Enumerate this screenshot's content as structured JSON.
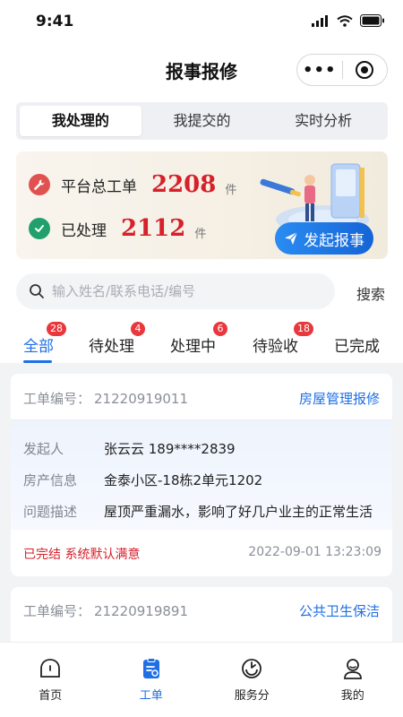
{
  "status_bar": {
    "time": "9:41"
  },
  "nav": {
    "title": "报事报修",
    "more_label": "•••"
  },
  "segments": [
    {
      "label": "我处理的",
      "active": true
    },
    {
      "label": "我提交的",
      "active": false
    },
    {
      "label": "实时分析",
      "active": false
    }
  ],
  "summary": {
    "total_label": "平台总工单",
    "total_value": "2208",
    "total_unit": "件",
    "done_label": "已处理",
    "done_value": "2112",
    "done_unit": "件",
    "report_button": "发起报事"
  },
  "search": {
    "placeholder": "输入姓名/联系电话/编号",
    "button": "搜索"
  },
  "status_tabs": [
    {
      "label": "全部",
      "badge": "28",
      "active": true
    },
    {
      "label": "待处理",
      "badge": "4",
      "active": false
    },
    {
      "label": "处理中",
      "badge": "6",
      "active": false
    },
    {
      "label": "待验收",
      "badge": "18",
      "active": false
    },
    {
      "label": "已完成",
      "badge": "",
      "active": false
    }
  ],
  "orders": [
    {
      "no_label": "工单编号：",
      "no": "21220919011",
      "type": "房屋管理报修",
      "fields": [
        {
          "k": "发起人",
          "v": "张云云 189****2839"
        },
        {
          "k": "房产信息",
          "v": "金泰小区-18栋2单元1202"
        },
        {
          "k": "问题描述",
          "v": "屋顶严重漏水，影响了好几户业主的正常生活"
        }
      ],
      "status": "已完结 系统默认满意",
      "time": "2022-09-01  13:23:09"
    },
    {
      "no_label": "工单编号：",
      "no": "21220919891",
      "type": "公共卫生保洁"
    }
  ],
  "tabbar": [
    {
      "label": "首页",
      "icon": "home-icon",
      "active": false
    },
    {
      "label": "工单",
      "icon": "ticket-icon",
      "active": true
    },
    {
      "label": "服务分",
      "icon": "score-icon",
      "active": false
    },
    {
      "label": "我的",
      "icon": "user-icon",
      "active": false
    }
  ],
  "colors": {
    "accent": "#1f6fe5",
    "danger": "#d6212b",
    "badge": "#e8383d"
  }
}
